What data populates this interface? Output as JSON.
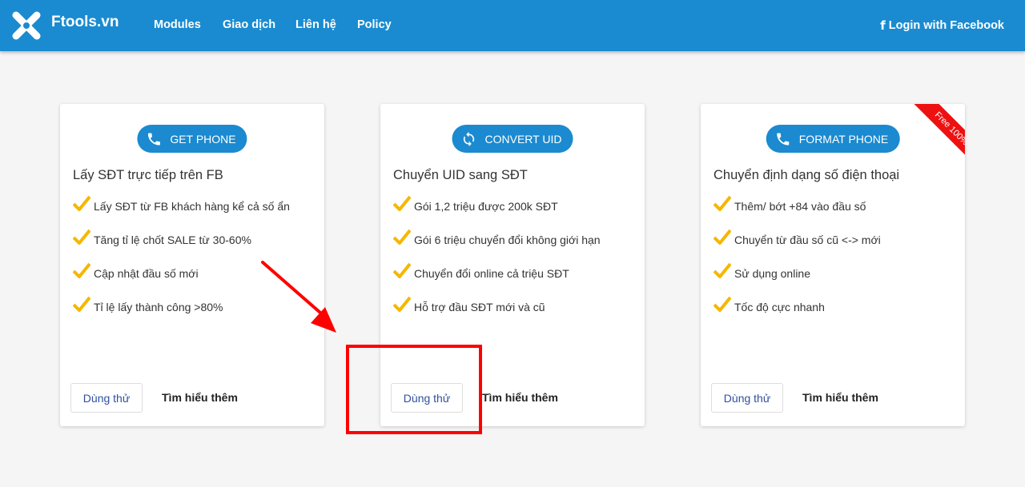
{
  "nav": {
    "brand": "Ftools.vn",
    "links": [
      "Modules",
      "Giao dịch",
      "Liên hệ",
      "Policy"
    ],
    "login": "Login with Facebook"
  },
  "cards": [
    {
      "pill": "GET PHONE",
      "title": "Lấy SĐT trực tiếp trên FB",
      "features": [
        "Lấy SĐT từ FB khách hàng kể cả số ẩn",
        "Tăng tỉ lệ chốt SALE từ 30-60%",
        "Cập nhật đầu số mới",
        "Tỉ lệ lấy thành công >80%"
      ],
      "try_label": "Dùng thử",
      "more_label": "Tìm hiểu thêm"
    },
    {
      "pill": "CONVERT UID",
      "title": "Chuyển UID sang SĐT",
      "features": [
        "Gói 1,2 triệu được 200k SĐT",
        "Gói 6 triệu chuyển đổi không giới hạn",
        "Chuyển đổi online cả triệu SĐT",
        "Hỗ trợ đầu SĐT mới và cũ"
      ],
      "try_label": "Dùng thử",
      "more_label": "Tìm hiểu thêm"
    },
    {
      "pill": "FORMAT PHONE",
      "title": "Chuyển định dạng số điện thoại",
      "features": [
        "Thêm/ bớt +84 vào đầu số",
        "Chuyển từ đầu số cũ <-> mới",
        "Sử dụng online",
        "Tốc độ cực nhanh"
      ],
      "try_label": "Dùng thử",
      "more_label": "Tìm hiểu thêm",
      "ribbon": "Free 100%"
    }
  ],
  "colors": {
    "navbar": "#1a8bd0",
    "pill": "#1b8ad0",
    "check": "#f5b700",
    "ribbon": "#ee1111",
    "annotation": "#ff0000"
  }
}
